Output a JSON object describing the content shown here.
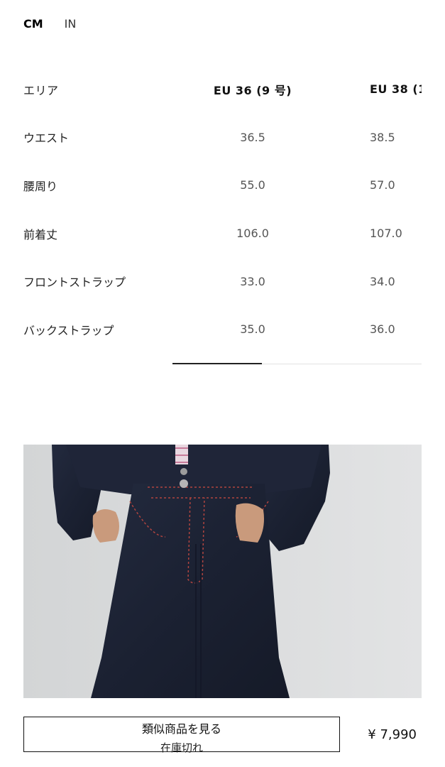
{
  "units": {
    "cm_label": "CM",
    "in_label": "IN"
  },
  "table": {
    "area_header": "エリア",
    "sizes": [
      "EU 36 (9 号)",
      "EU 38 (1"
    ],
    "rows": [
      {
        "label": "ウエスト",
        "values": [
          "36.5",
          "38.5"
        ]
      },
      {
        "label": "腰周り",
        "values": [
          "55.0",
          "57.0"
        ]
      },
      {
        "label": "前着丈",
        "values": [
          "106.0",
          "107.0"
        ]
      },
      {
        "label": "フロントストラップ",
        "values": [
          "33.0",
          "34.0"
        ]
      },
      {
        "label": "バックストラップ",
        "values": [
          "35.0",
          "36.0"
        ]
      }
    ]
  },
  "product": {
    "similar_label": "類似商品を見る",
    "status": "在庫切れ",
    "price": "¥ 7,990"
  },
  "colors": {
    "denim": "#1d2233",
    "stitch": "#b0443f",
    "background_photo": "#d9dbdc"
  }
}
